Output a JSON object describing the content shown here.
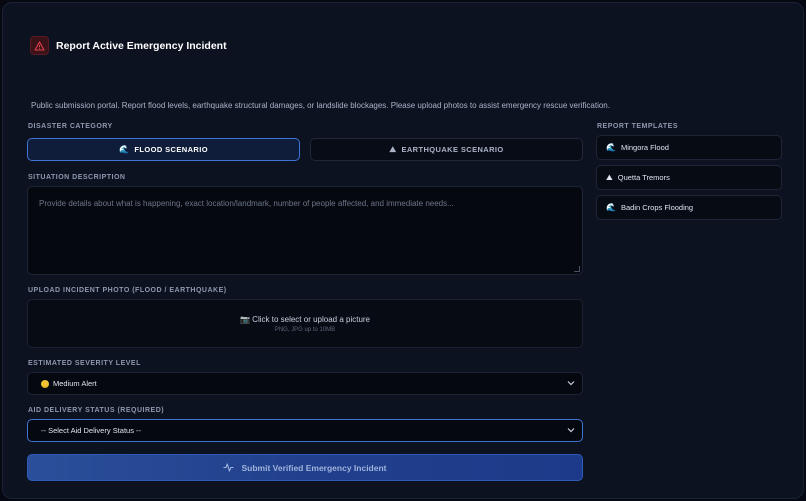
{
  "form": {
    "title": "Report Active Emergency Incident",
    "intro": "Public submission portal. Report flood levels, earthquake structural damages, or landslide blockages. Please upload photos to assist emergency rescue verification.",
    "category_label": "DISASTER CATEGORY",
    "scenarios": [
      {
        "label": "FLOOD SCENARIO",
        "icon": "wave-icon",
        "glyph": "🌊",
        "active": true
      },
      {
        "label": "EARTHQUAKE SCENARIO",
        "icon": "mountain-icon",
        "glyph": "⛰",
        "active": false
      }
    ],
    "description_label": "SITUATION DESCRIPTION",
    "description_placeholder": "Provide details about what is happening, exact location/landmark, number of people affected, and immediate needs...",
    "upload_label": "UPLOAD INCIDENT PHOTO (FLOOD / EARTHQUAKE)",
    "upload_text": "Click to select or upload a picture",
    "upload_icon": "camera-icon",
    "upload_glyph": "📷",
    "upload_hint": "PNG, JPG up to 10MB",
    "severity_label": "ESTIMATED SEVERITY LEVEL",
    "severity_value": "Medium Alert",
    "aid_label": "AID DELIVERY STATUS (REQUIRED)",
    "aid_value": "-- Select Aid Delivery Status --",
    "submit_label": "Submit Verified Emergency Incident",
    "submit_icon": "activity-icon"
  },
  "templates": {
    "heading": "REPORT TEMPLATES",
    "items": [
      {
        "label": "Mingora Flood",
        "icon": "wave-icon",
        "glyph": "🌊"
      },
      {
        "label": "Quetta Tremors",
        "icon": "mountain-icon",
        "glyph": "⛰"
      },
      {
        "label": "Badin Crops Flooding",
        "icon": "wave-icon",
        "glyph": "🌊"
      }
    ]
  },
  "colors": {
    "accent": "#3f73d6",
    "background": "#0c1220",
    "warning": "#e0434f",
    "severity_medium": "#f1c232"
  }
}
